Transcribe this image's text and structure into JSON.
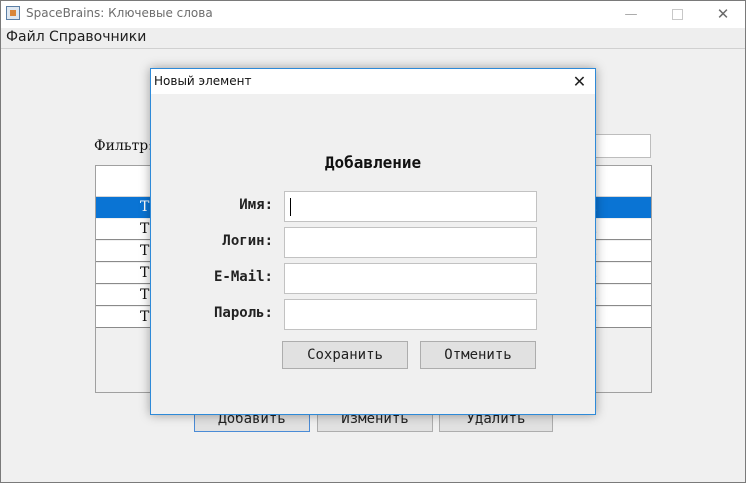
{
  "window": {
    "title": "SpaceBrains: Ключевые слова",
    "controls": {
      "minimize": "—",
      "close": "✕"
    }
  },
  "menu": {
    "items": [
      "Файл",
      "Справочники"
    ]
  },
  "main": {
    "filter_label": "Фильтр:",
    "table": {
      "rows": [
        {
          "a": "Те",
          "b": ".",
          "selected": true
        },
        {
          "a": "Те",
          "b": "."
        },
        {
          "a": "Те",
          "b": "."
        },
        {
          "a": "Те",
          "b": "."
        },
        {
          "a": "Те",
          "b": "."
        },
        {
          "a": "Те",
          "b": "."
        }
      ]
    },
    "buttons": {
      "add": "Добавить",
      "edit": "Изменить",
      "delete": "Удалить"
    }
  },
  "dialog": {
    "title": "Новый элемент",
    "close": "✕",
    "heading": "Добавление",
    "fields": [
      {
        "label": "Имя:",
        "value": ""
      },
      {
        "label": "Логин:",
        "value": ""
      },
      {
        "label": "E-Mail:",
        "value": ""
      },
      {
        "label": "Пароль:",
        "value": ""
      }
    ],
    "buttons": {
      "save": "Сохранить",
      "cancel": "Отменить"
    }
  },
  "colors": {
    "selection": "#0a74d4",
    "dialog_border": "#2e8ad8"
  }
}
